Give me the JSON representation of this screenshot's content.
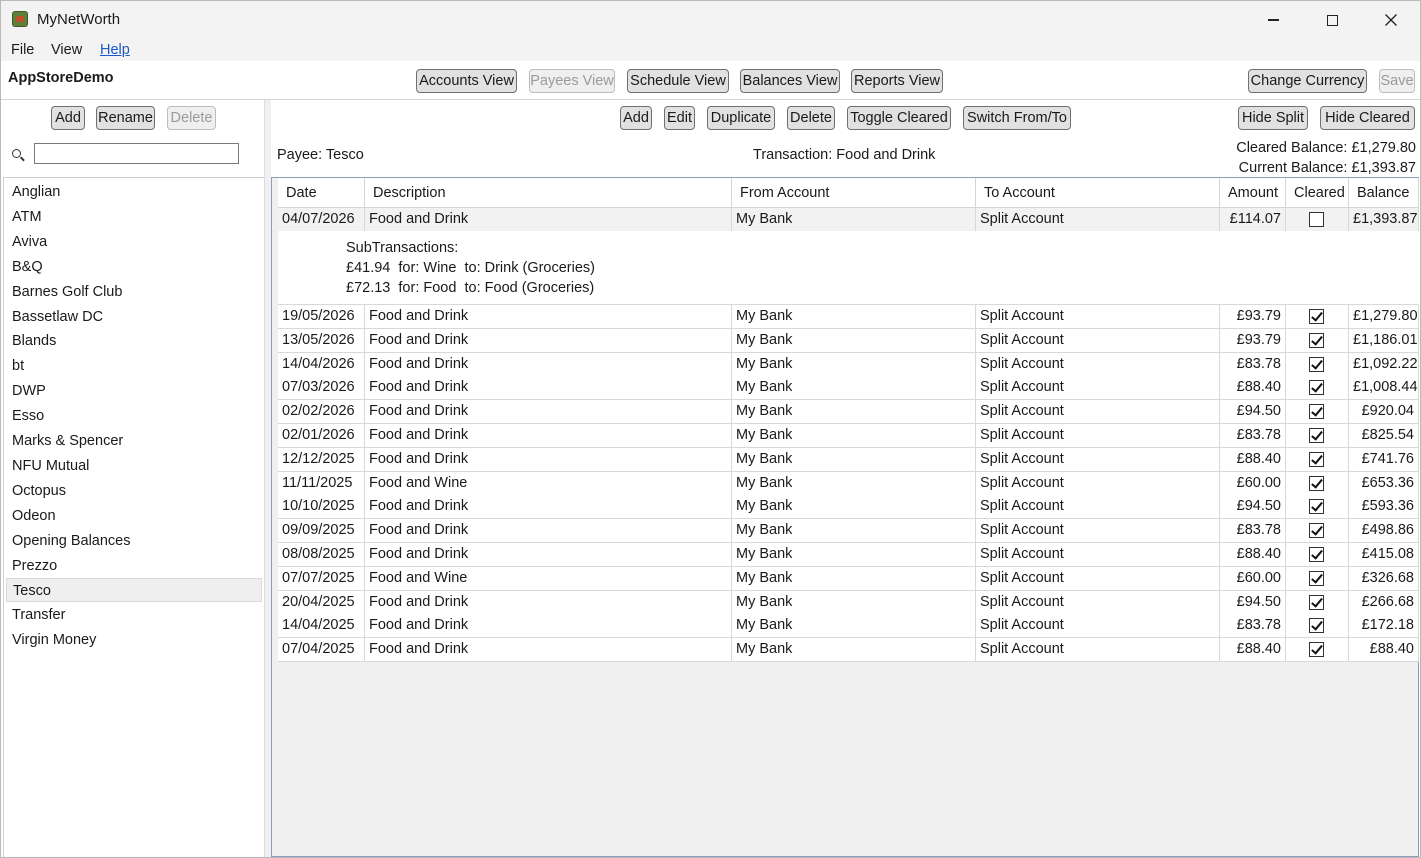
{
  "window": {
    "title": "MyNetWorth",
    "minimize_icon": "minimize-icon",
    "maximize_icon": "maximize-icon",
    "close_icon": "close-icon"
  },
  "menu": {
    "file": "File",
    "view": "View",
    "help": "Help"
  },
  "toolbar": {
    "brand": "AppStoreDemo",
    "accounts_view": "Accounts View",
    "payees_view": "Payees View",
    "schedule_view": "Schedule View",
    "balances_view": "Balances View",
    "reports_view": "Reports View",
    "change_currency": "Change Currency",
    "save": "Save"
  },
  "left": {
    "add": "Add",
    "rename": "Rename",
    "delete": "Delete",
    "search_value": "",
    "payees": [
      "Anglian",
      "ATM",
      "Aviva",
      "B&Q",
      "Barnes Golf Club",
      "Bassetlaw DC",
      "Blands",
      "bt",
      "DWP",
      "Esso",
      "Marks & Spencer",
      "NFU Mutual",
      "Octopus",
      "Odeon",
      "Opening Balances",
      "Prezzo",
      "Tesco",
      "Transfer",
      "Virgin Money"
    ],
    "selected_payee": "Tesco"
  },
  "right": {
    "add": "Add",
    "edit": "Edit",
    "duplicate": "Duplicate",
    "delete": "Delete",
    "toggle_cleared": "Toggle Cleared",
    "switch_from_to": "Switch From/To",
    "hide_split": "Hide Split",
    "hide_cleared": "Hide Cleared",
    "payee_label": "Payee: Tesco",
    "transaction_label": "Transaction: Food and Drink",
    "cleared_balance": "Cleared Balance: £1,279.80",
    "current_balance": "Current Balance: £1,393.87"
  },
  "table": {
    "headers": [
      "Date",
      "Description",
      "From Account",
      "To Account",
      "Amount",
      "Cleared",
      "Balance"
    ],
    "rows": [
      {
        "date": "04/07/2026",
        "desc": "Food and Drink",
        "from": "My Bank",
        "to": "Split Account",
        "amount": "£114.07",
        "cleared": false,
        "balance": "£1,393.87"
      },
      {
        "date": "19/05/2026",
        "desc": "Food and Drink",
        "from": "My Bank",
        "to": "Split Account",
        "amount": "£93.79",
        "cleared": true,
        "balance": "£1,279.80"
      },
      {
        "date": "13/05/2026",
        "desc": "Food and Drink",
        "from": "My Bank",
        "to": "Split Account",
        "amount": "£93.79",
        "cleared": true,
        "balance": "£1,186.01"
      },
      {
        "date": "14/04/2026",
        "desc": "Food and Drink",
        "from": "My Bank",
        "to": "Split Account",
        "amount": "£83.78",
        "cleared": true,
        "balance": "£1,092.22"
      },
      {
        "date": "07/03/2026",
        "desc": "Food and Drink",
        "from": "My Bank",
        "to": "Split Account",
        "amount": "£88.40",
        "cleared": true,
        "balance": "£1,008.44"
      },
      {
        "date": "02/02/2026",
        "desc": "Food and Drink",
        "from": "My Bank",
        "to": "Split Account",
        "amount": "£94.50",
        "cleared": true,
        "balance": "£920.04"
      },
      {
        "date": "02/01/2026",
        "desc": "Food and Drink",
        "from": "My Bank",
        "to": "Split Account",
        "amount": "£83.78",
        "cleared": true,
        "balance": "£825.54"
      },
      {
        "date": "12/12/2025",
        "desc": "Food and Drink",
        "from": "My Bank",
        "to": "Split Account",
        "amount": "£88.40",
        "cleared": true,
        "balance": "£741.76"
      },
      {
        "date": "11/11/2025",
        "desc": "Food and Wine",
        "from": "My Bank",
        "to": "Split Account",
        "amount": "£60.00",
        "cleared": true,
        "balance": "£653.36"
      },
      {
        "date": "10/10/2025",
        "desc": "Food and Drink",
        "from": "My Bank",
        "to": "Split Account",
        "amount": "£94.50",
        "cleared": true,
        "balance": "£593.36"
      },
      {
        "date": "09/09/2025",
        "desc": "Food and Drink",
        "from": "My Bank",
        "to": "Split Account",
        "amount": "£83.78",
        "cleared": true,
        "balance": "£498.86"
      },
      {
        "date": "08/08/2025",
        "desc": "Food and Drink",
        "from": "My Bank",
        "to": "Split Account",
        "amount": "£88.40",
        "cleared": true,
        "balance": "£415.08"
      },
      {
        "date": "07/07/2025",
        "desc": "Food and Wine",
        "from": "My Bank",
        "to": "Split Account",
        "amount": "£60.00",
        "cleared": true,
        "balance": "£326.68"
      },
      {
        "date": "20/04/2025",
        "desc": "Food and Drink",
        "from": "My Bank",
        "to": "Split Account",
        "amount": "£94.50",
        "cleared": true,
        "balance": "£266.68"
      },
      {
        "date": "14/04/2025",
        "desc": "Food and Drink",
        "from": "My Bank",
        "to": "Split Account",
        "amount": "£83.78",
        "cleared": true,
        "balance": "£172.18"
      },
      {
        "date": "07/04/2025",
        "desc": "Food and Drink",
        "from": "My Bank",
        "to": "Split Account",
        "amount": "£88.40",
        "cleared": true,
        "balance": "£88.40"
      }
    ],
    "subtransactions": {
      "title": "SubTransactions:",
      "lines": [
        "£41.94  for: Wine  to: Drink (Groceries)",
        "£72.13  for: Food  to: Food (Groceries)"
      ]
    }
  }
}
